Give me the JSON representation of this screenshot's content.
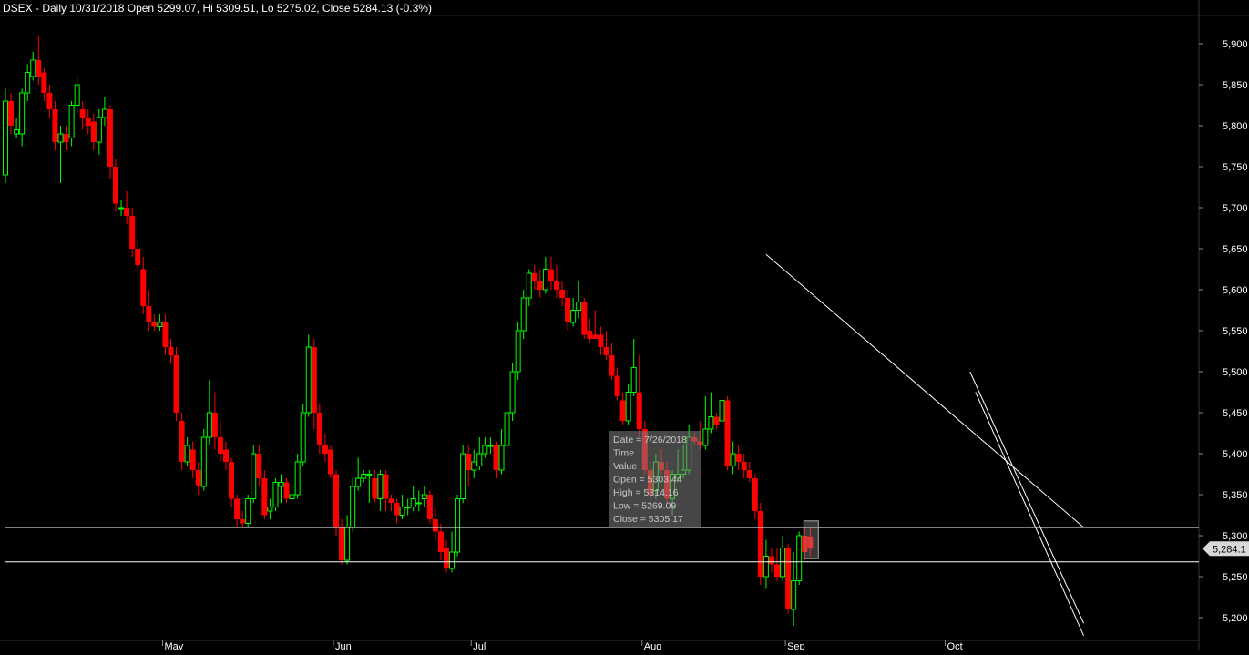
{
  "title": "DSEX - Daily 10/31/2018 Open 5299.07, Hi 5309.51, Lo 5275.02, Close 5284.13 (-0.3%)",
  "last_price_label": "5,284.1",
  "colors": {
    "background": "#000000",
    "up": "#00ff00",
    "down": "#ff0000",
    "axis_text": "#ffffff",
    "lines": "#ffffff",
    "tooltip_bg": "#808080"
  },
  "tooltip": {
    "lines": [
      "Date = 7/26/2018",
      "Time",
      "Value",
      "Open = 5303.44",
      "High = 5314.16",
      "Low = 5269.09",
      "Close = 5305.17"
    ]
  },
  "chart_data": {
    "type": "candlestick",
    "y_axis": {
      "ticks": [
        5200,
        5250,
        5300,
        5350,
        5400,
        5450,
        5500,
        5550,
        5600,
        5650,
        5700,
        5750,
        5800,
        5850,
        5900
      ],
      "tick_labels": [
        "5,200",
        "5,250",
        "5,300",
        "5,350",
        "5,400",
        "5,450",
        "5,500",
        "5,550",
        "5,600",
        "5,650",
        "5,700",
        "5,750",
        "5,800",
        "5,850",
        "5,900"
      ],
      "range": [
        5160,
        5950
      ]
    },
    "x_axis": {
      "month_labels": [
        {
          "label": "May",
          "index": 29
        },
        {
          "label": "Jun",
          "index": 60
        },
        {
          "label": "Jul",
          "index": 85
        },
        {
          "label": "Aug",
          "index": 116
        },
        {
          "label": "Sep",
          "index": 142
        },
        {
          "label": "Oct",
          "index": 171
        }
      ]
    },
    "candles": [
      [
        5740,
        5830,
        5845,
        5730
      ],
      [
        5830,
        5800,
        5840,
        5790
      ],
      [
        5790,
        5795,
        5810,
        5785
      ],
      [
        5790,
        5840,
        5845,
        5775
      ],
      [
        5840,
        5865,
        5875,
        5830
      ],
      [
        5860,
        5880,
        5890,
        5855
      ],
      [
        5880,
        5860,
        5910,
        5850
      ],
      [
        5865,
        5840,
        5870,
        5830
      ],
      [
        5840,
        5820,
        5850,
        5810
      ],
      [
        5820,
        5780,
        5830,
        5770
      ],
      [
        5780,
        5790,
        5800,
        5730
      ],
      [
        5790,
        5780,
        5800,
        5770
      ],
      [
        5785,
        5825,
        5830,
        5775
      ],
      [
        5825,
        5850,
        5860,
        5815
      ],
      [
        5820,
        5810,
        5830,
        5795
      ],
      [
        5810,
        5800,
        5820,
        5790
      ],
      [
        5805,
        5780,
        5815,
        5770
      ],
      [
        5780,
        5810,
        5820,
        5765
      ],
      [
        5810,
        5820,
        5835,
        5800
      ],
      [
        5820,
        5750,
        5825,
        5735
      ],
      [
        5750,
        5705,
        5760,
        5695
      ],
      [
        5700,
        5700,
        5710,
        5690
      ],
      [
        5700,
        5690,
        5720,
        5680
      ],
      [
        5690,
        5650,
        5700,
        5640
      ],
      [
        5650,
        5630,
        5660,
        5620
      ],
      [
        5625,
        5580,
        5640,
        5570
      ],
      [
        5580,
        5560,
        5600,
        5550
      ],
      [
        5560,
        5555,
        5570,
        5550
      ],
      [
        5555,
        5560,
        5570,
        5550
      ],
      [
        5560,
        5530,
        5570,
        5520
      ],
      [
        5530,
        5520,
        5540,
        5510
      ],
      [
        5520,
        5450,
        5530,
        5440
      ],
      [
        5440,
        5390,
        5450,
        5380
      ],
      [
        5390,
        5410,
        5420,
        5385
      ],
      [
        5405,
        5380,
        5415,
        5370
      ],
      [
        5380,
        5360,
        5390,
        5350
      ],
      [
        5360,
        5420,
        5430,
        5355
      ],
      [
        5420,
        5450,
        5490,
        5410
      ],
      [
        5450,
        5420,
        5475,
        5405
      ],
      [
        5420,
        5400,
        5440,
        5390
      ],
      [
        5405,
        5390,
        5415,
        5380
      ],
      [
        5390,
        5345,
        5395,
        5335
      ],
      [
        5345,
        5320,
        5350,
        5310
      ],
      [
        5320,
        5315,
        5330,
        5310
      ],
      [
        5315,
        5345,
        5350,
        5310
      ],
      [
        5345,
        5400,
        5410,
        5340
      ],
      [
        5400,
        5370,
        5410,
        5360
      ],
      [
        5370,
        5325,
        5380,
        5320
      ],
      [
        5330,
        5335,
        5345,
        5320
      ],
      [
        5335,
        5365,
        5370,
        5330
      ],
      [
        5360,
        5365,
        5375,
        5340
      ],
      [
        5365,
        5345,
        5370,
        5340
      ],
      [
        5345,
        5350,
        5370,
        5340
      ],
      [
        5350,
        5390,
        5400,
        5345
      ],
      [
        5390,
        5450,
        5460,
        5385
      ],
      [
        5450,
        5530,
        5545,
        5445
      ],
      [
        5530,
        5450,
        5540,
        5430
      ],
      [
        5450,
        5410,
        5460,
        5400
      ],
      [
        5410,
        5400,
        5425,
        5390
      ],
      [
        5405,
        5375,
        5410,
        5370
      ],
      [
        5375,
        5310,
        5380,
        5300
      ],
      [
        5310,
        5270,
        5320,
        5265
      ],
      [
        5270,
        5310,
        5325,
        5265
      ],
      [
        5310,
        5360,
        5370,
        5305
      ],
      [
        5360,
        5370,
        5395,
        5355
      ],
      [
        5370,
        5375,
        5380,
        5365
      ],
      [
        5375,
        5375,
        5380,
        5340
      ],
      [
        5370,
        5345,
        5380,
        5340
      ],
      [
        5345,
        5375,
        5380,
        5330
      ],
      [
        5375,
        5345,
        5380,
        5330
      ],
      [
        5345,
        5340,
        5350,
        5330
      ],
      [
        5340,
        5325,
        5345,
        5315
      ],
      [
        5325,
        5335,
        5350,
        5320
      ],
      [
        5335,
        5335,
        5345,
        5325
      ],
      [
        5335,
        5345,
        5360,
        5330
      ],
      [
        5340,
        5340,
        5355,
        5330
      ],
      [
        5345,
        5350,
        5360,
        5335
      ],
      [
        5350,
        5320,
        5355,
        5315
      ],
      [
        5320,
        5305,
        5335,
        5295
      ],
      [
        5305,
        5280,
        5315,
        5270
      ],
      [
        5285,
        5260,
        5295,
        5255
      ],
      [
        5260,
        5280,
        5305,
        5255
      ],
      [
        5280,
        5345,
        5350,
        5275
      ],
      [
        5345,
        5400,
        5410,
        5340
      ],
      [
        5400,
        5380,
        5410,
        5360
      ],
      [
        5380,
        5390,
        5405,
        5370
      ],
      [
        5385,
        5400,
        5420,
        5380
      ],
      [
        5400,
        5410,
        5420,
        5395
      ],
      [
        5410,
        5410,
        5420,
        5400
      ],
      [
        5410,
        5380,
        5415,
        5370
      ],
      [
        5380,
        5410,
        5430,
        5375
      ],
      [
        5410,
        5450,
        5460,
        5400
      ],
      [
        5450,
        5500,
        5510,
        5440
      ],
      [
        5500,
        5550,
        5560,
        5490
      ],
      [
        5550,
        5590,
        5600,
        5540
      ],
      [
        5590,
        5620,
        5625,
        5580
      ],
      [
        5620,
        5610,
        5630,
        5600
      ],
      [
        5610,
        5600,
        5625,
        5590
      ],
      [
        5600,
        5625,
        5640,
        5595
      ],
      [
        5625,
        5610,
        5640,
        5600
      ],
      [
        5610,
        5600,
        5630,
        5590
      ],
      [
        5600,
        5590,
        5610,
        5580
      ],
      [
        5590,
        5560,
        5600,
        5550
      ],
      [
        5560,
        5575,
        5590,
        5555
      ],
      [
        5575,
        5585,
        5610,
        5565
      ],
      [
        5585,
        5545,
        5590,
        5540
      ],
      [
        5550,
        5540,
        5565,
        5535
      ],
      [
        5545,
        5540,
        5575,
        5540
      ],
      [
        5545,
        5530,
        5555,
        5520
      ],
      [
        5530,
        5520,
        5550,
        5515
      ],
      [
        5520,
        5495,
        5535,
        5490
      ],
      [
        5495,
        5470,
        5505,
        5465
      ],
      [
        5465,
        5440,
        5475,
        5435
      ],
      [
        5440,
        5475,
        5485,
        5435
      ],
      [
        5475,
        5505,
        5540,
        5470
      ],
      [
        5475,
        5430,
        5520,
        5420
      ],
      [
        5430,
        5380,
        5440,
        5375
      ],
      [
        5380,
        5350,
        5390,
        5345
      ],
      [
        5355,
        5390,
        5400,
        5345
      ],
      [
        5390,
        5380,
        5405,
        5375
      ],
      [
        5380,
        5345,
        5390,
        5340
      ],
      [
        5345,
        5375,
        5380,
        5325
      ],
      [
        5370,
        5375,
        5405,
        5365
      ],
      [
        5375,
        5380,
        5410,
        5370
      ],
      [
        5380,
        5420,
        5435,
        5375
      ],
      [
        5420,
        5415,
        5425,
        5410
      ],
      [
        5415,
        5410,
        5440,
        5405
      ],
      [
        5410,
        5430,
        5470,
        5405
      ],
      [
        5430,
        5445,
        5475,
        5425
      ],
      [
        5445,
        5435,
        5450,
        5430
      ],
      [
        5440,
        5465,
        5500,
        5435
      ],
      [
        5465,
        5385,
        5470,
        5380
      ],
      [
        5385,
        5400,
        5415,
        5375
      ],
      [
        5400,
        5390,
        5410,
        5380
      ],
      [
        5390,
        5380,
        5400,
        5370
      ],
      [
        5380,
        5370,
        5390,
        5365
      ],
      [
        5370,
        5330,
        5375,
        5320
      ],
      [
        5330,
        5250,
        5340,
        5240
      ],
      [
        5250,
        5275,
        5295,
        5235
      ],
      [
        5275,
        5265,
        5285,
        5255
      ],
      [
        5265,
        5250,
        5285,
        5245
      ],
      [
        5250,
        5285,
        5300,
        5245
      ],
      [
        5285,
        5210,
        5290,
        5205
      ],
      [
        5210,
        5245,
        5280,
        5190
      ],
      [
        5245,
        5300,
        5305,
        5240
      ],
      [
        5300,
        5280,
        5310,
        5270
      ],
      [
        5299.07,
        5284.13,
        5309.51,
        5275.02
      ]
    ],
    "horizontal_lines": [
      5310,
      5268
    ],
    "trendlines": [
      {
        "from": {
          "index": 138,
          "value": 5643
        },
        "to": {
          "index": 191,
          "value": 5310
        }
      },
      {
        "from": {
          "index": 175,
          "value": 5500
        },
        "to": {
          "index": 191,
          "value": 5193
        }
      },
      {
        "from": {
          "index": 176,
          "value": 5475
        },
        "to": {
          "index": 191,
          "value": 5178
        }
      }
    ]
  }
}
